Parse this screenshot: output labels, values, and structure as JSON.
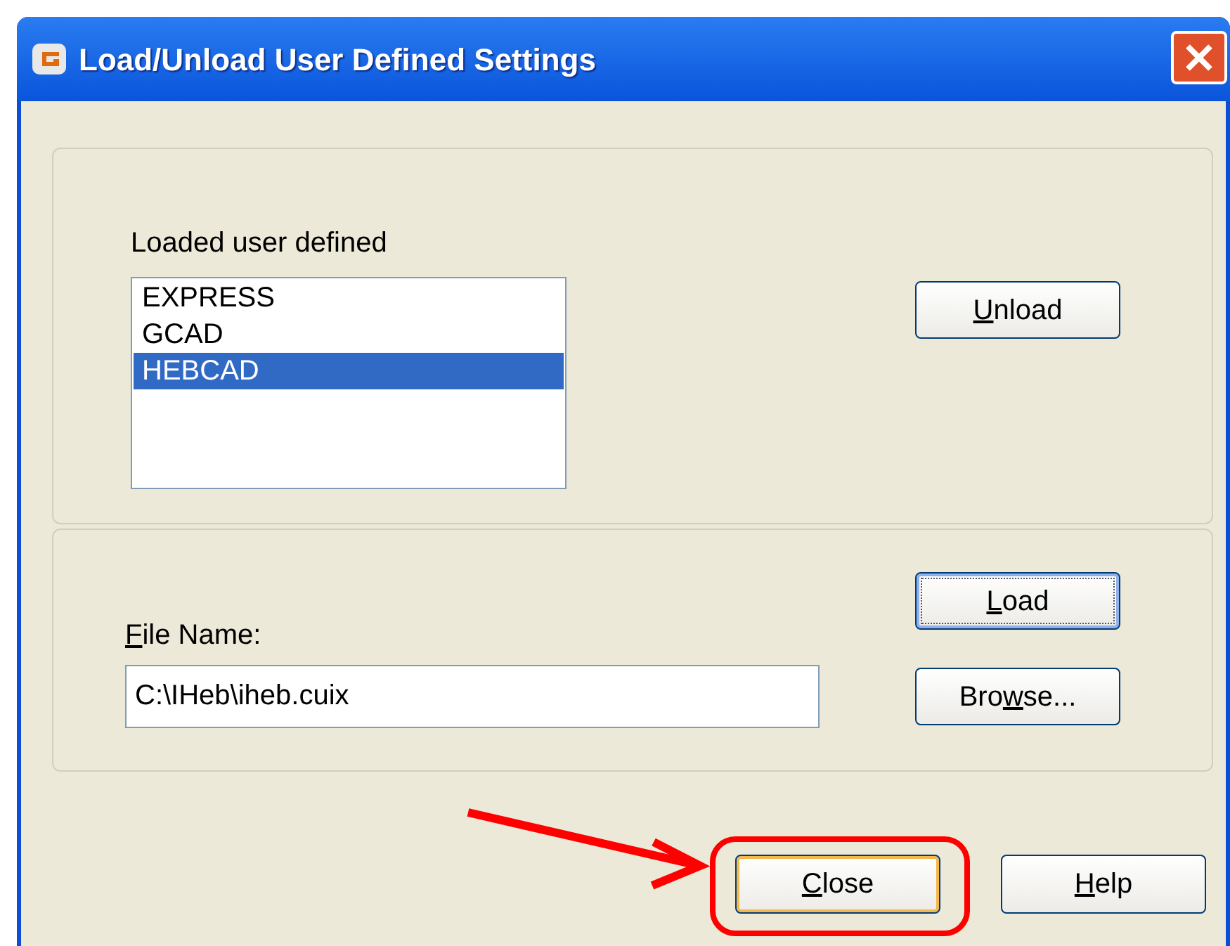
{
  "window": {
    "title": "Load/Unload User Defined Settings"
  },
  "loaded_group": {
    "label": "Loaded user defined",
    "items": [
      {
        "text": "EXPRESS",
        "selected": false
      },
      {
        "text": "GCAD",
        "selected": false
      },
      {
        "text": "HEBCAD",
        "selected": true
      }
    ],
    "unload_button": {
      "key": "U",
      "post": "nload",
      "focused": false
    }
  },
  "file_group": {
    "load_button": {
      "key": "L",
      "post": "oad",
      "focused": true
    },
    "file_label": {
      "key": "F",
      "post": "ile Name:"
    },
    "file_name": "C:\\IHeb\\iheb.cuix",
    "browse_button": {
      "pre": "Bro",
      "key": "w",
      "post": "se...",
      "focused": false
    }
  },
  "footer_buttons": [
    {
      "key": "C",
      "post": "lose",
      "default": true
    },
    {
      "key": "H",
      "post": "elp",
      "default": false
    }
  ]
}
